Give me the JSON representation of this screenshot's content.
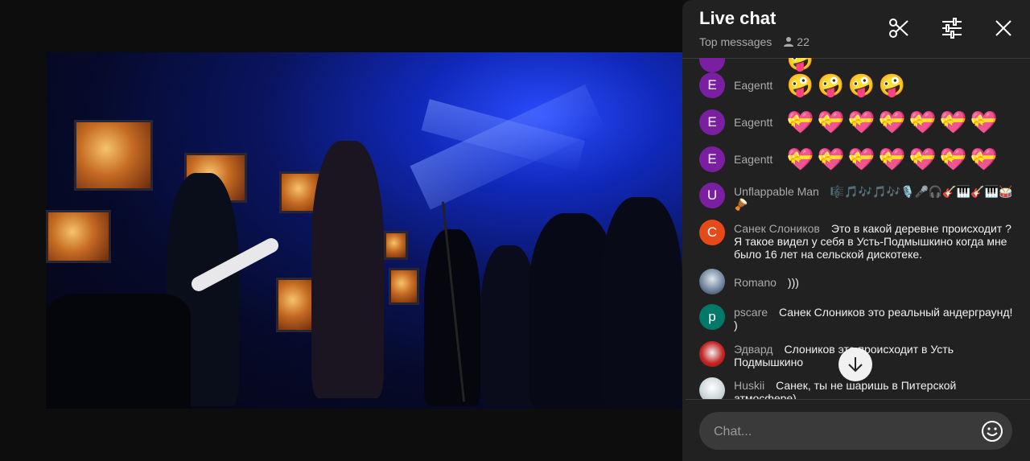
{
  "chat": {
    "title": "Live chat",
    "mode": "Top messages",
    "viewer_count": "22",
    "input_placeholder": "Chat..."
  },
  "messages": [
    {
      "author": "Eagentt",
      "initial": "E",
      "avatar_color": "#7b1fa2",
      "emoji": "face-emoji",
      "count": 4
    },
    {
      "author": "Eagentt",
      "initial": "E",
      "avatar_color": "#7b1fa2",
      "emoji": "heart-emoji",
      "count": 7
    },
    {
      "author": "Eagentt",
      "initial": "E",
      "avatar_color": "#7b1fa2",
      "emoji": "heart-emoji",
      "count": 7
    },
    {
      "author": "Unflappable Man",
      "initial": "U",
      "avatar_color": "#7b1fa2",
      "text": "🎼🎵🎶🎵🎶🎙️🎤🎧🎸🎹🎸🎹🥁🪘"
    },
    {
      "author": "Санек Слоников",
      "initial": "С",
      "avatar_color": "#e64a19",
      "text": "Это в какой деревне происходит ? Я такое видел у себя в Усть-Подмышкино когда мне было 16 лет на сельской дискотеке."
    },
    {
      "author": "Romano",
      "initial": "",
      "avatar_color": "#b0bec5",
      "text": ")))"
    },
    {
      "author": "pscare",
      "initial": "p",
      "avatar_color": "#00796b",
      "text": "Санек Слоников это реальный андерграунд! )"
    },
    {
      "author": "Эдвард",
      "initial": "",
      "avatar_color": "#c62828",
      "text": "Слоников это происходит в Усть Подмышкино"
    },
    {
      "author": "Huskii",
      "initial": "",
      "avatar_color": "#cfd8dc",
      "text": "Санек, ты не шаришь в Питерской атмосфере)"
    }
  ],
  "colors": {
    "panel": "#212121",
    "accent_text": "#aaaaaa"
  }
}
